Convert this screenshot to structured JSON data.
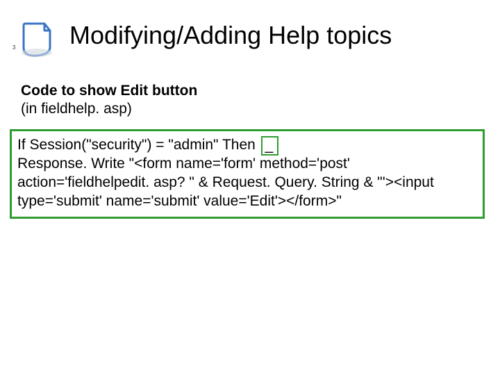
{
  "page_number": "3",
  "title": "Modifying/Adding Help topics",
  "subtitle": {
    "bold": "Code to show Edit button",
    "plain": "(in fieldhelp. asp)"
  },
  "code": {
    "line1_prefix": "If Session(\"security\") = \"admin\" Then",
    "underscore": "_",
    "rest": "Response. Write \"<form name='form' method='post' action='fieldhelpedit. asp? \" & Request. Query. String & \"'><input type='submit' name='submit' value='Edit'></form>\""
  }
}
